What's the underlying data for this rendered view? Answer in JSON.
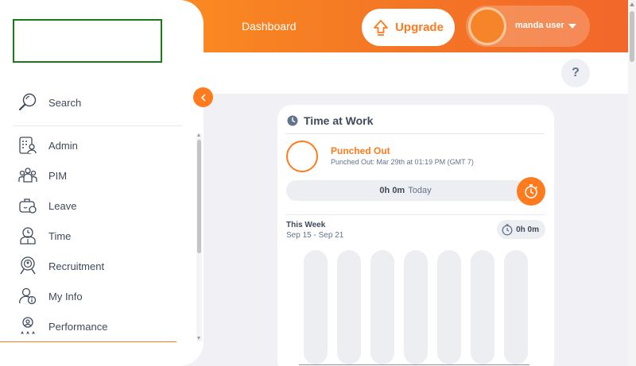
{
  "header": {
    "title": "Dashboard",
    "upgrade_label": "Upgrade",
    "user_name": "manda user",
    "help_label": "?"
  },
  "sidebar": {
    "search_label": "Search",
    "items": [
      {
        "label": "Admin",
        "icon": "admin-icon"
      },
      {
        "label": "PIM",
        "icon": "pim-icon"
      },
      {
        "label": "Leave",
        "icon": "leave-icon"
      },
      {
        "label": "Time",
        "icon": "time-icon"
      },
      {
        "label": "Recruitment",
        "icon": "recruitment-icon"
      },
      {
        "label": "My Info",
        "icon": "my-info-icon"
      },
      {
        "label": "Performance",
        "icon": "performance-icon"
      }
    ]
  },
  "time_at_work": {
    "title": "Time at Work",
    "status": "Punched Out",
    "status_detail": "Punched Out: Mar 29th at 01:19 PM (GMT 7)",
    "today_hours": "0h 0m",
    "today_label": "Today",
    "week_label": "This Week",
    "week_range": "Sep 15 - Sep 21",
    "week_total": "0h 0m"
  },
  "colors": {
    "accent": "#ff7b1d",
    "header_gradient_start": "#ff9a1f",
    "header_gradient_end": "#f2662a",
    "text": "#3e4a5a"
  }
}
